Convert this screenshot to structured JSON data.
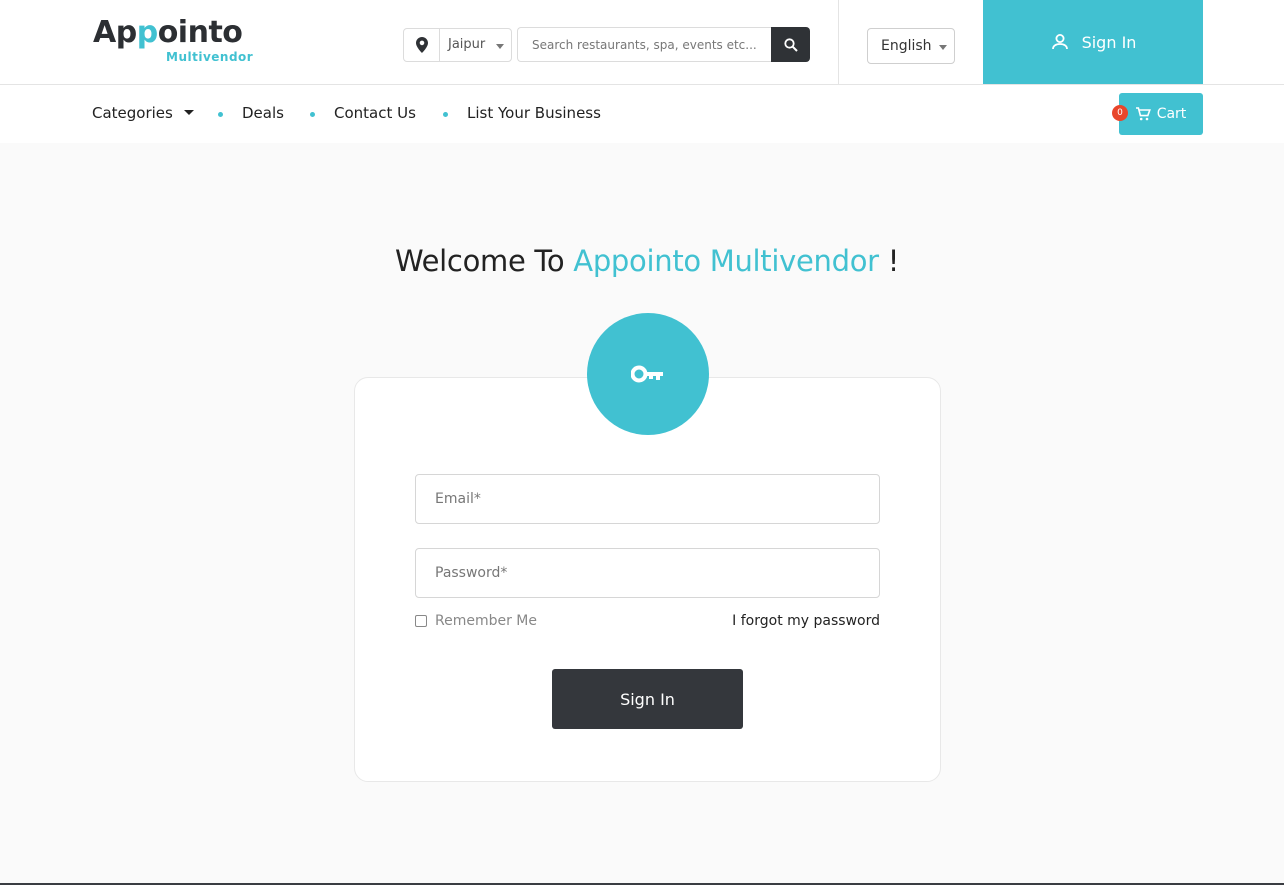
{
  "brand": {
    "name_part1": "Ap",
    "name_accent": "p",
    "name_part2": "ointo",
    "sub": "Multivendor"
  },
  "location": {
    "selected": "Jaipur"
  },
  "search": {
    "placeholder": "Search restaurants, spa, events etc..."
  },
  "language": {
    "selected": "English"
  },
  "header": {
    "signin_label": "Sign In"
  },
  "nav": {
    "items": [
      {
        "label": "Categories"
      },
      {
        "label": "Deals"
      },
      {
        "label": "Contact Us"
      },
      {
        "label": "List Your Business"
      }
    ]
  },
  "cart": {
    "label": "Cart",
    "count": "0"
  },
  "welcome": {
    "prefix": "Welcome To ",
    "accent": "Appointo Multivendor",
    "suffix": " !"
  },
  "form": {
    "email_placeholder": "Email*",
    "password_placeholder": "Password*",
    "remember_label": "Remember Me",
    "forgot_label": "I forgot my password",
    "submit_label": "Sign In"
  },
  "colors": {
    "accent": "#41c1d1",
    "dark": "#34373c",
    "badge": "#e8462b"
  },
  "icons": {
    "location": "map-pin-icon",
    "search": "magnifier-icon",
    "user": "user-icon",
    "cart": "cart-icon",
    "key": "key-icon"
  }
}
